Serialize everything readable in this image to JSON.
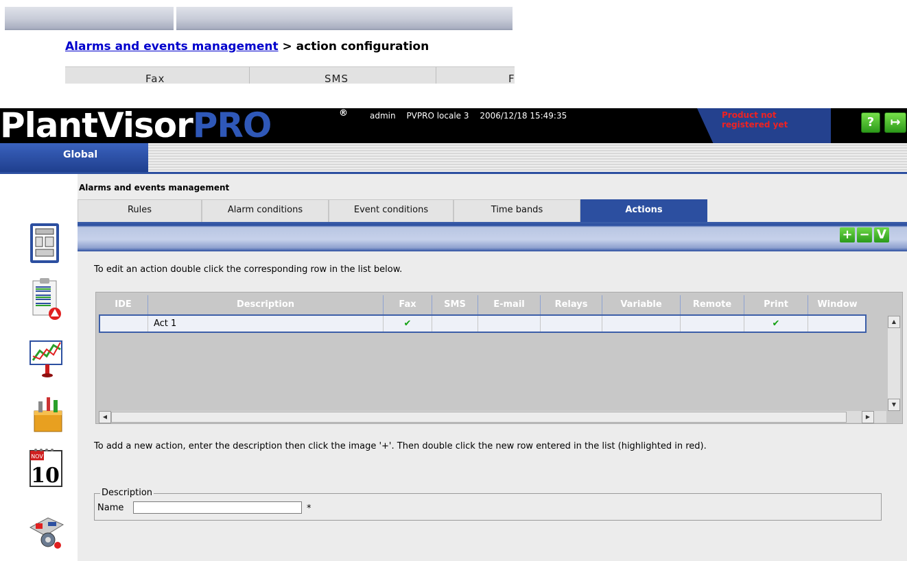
{
  "snippet": {
    "breadcrumb_link": "Alarms and events management",
    "breadcrumb_rest": " > action configuration",
    "tabs": [
      "Fax",
      "SMS",
      "F"
    ]
  },
  "header": {
    "logo_part1": "PlantVisor",
    "logo_part2": "PRO",
    "logo_reg": "®",
    "user": "admin",
    "site": "PVPRO locale 3",
    "datetime": "2006/12/18 15:49:35",
    "notice_line1": "Product not",
    "notice_line2": "registered yet",
    "help_icon": "help-icon",
    "logout_icon": "logout-icon",
    "help_glyph": "?",
    "logout_glyph": "↦"
  },
  "nav": {
    "global_label": "Global"
  },
  "rail_icons": [
    "layout-icon",
    "alarm-list-icon",
    "chart-icon",
    "toolbox-icon",
    "calendar-icon",
    "plant-settings-icon"
  ],
  "calendar": {
    "month": "NOV",
    "day": "10"
  },
  "section": {
    "title": "Alarms and events management",
    "tabs": [
      "Rules",
      "Alarm conditions",
      "Event conditions",
      "Time bands",
      "Actions"
    ],
    "active_tab": "Actions"
  },
  "toolbar": {
    "add": "+",
    "remove": "−",
    "confirm": "V"
  },
  "instructions": {
    "edit": "To edit an action double click the corresponding row in the list below.",
    "add": "To add a new action, enter the description then click the image '+'. Then double click the new row entered in the list (highlighted in red)."
  },
  "table": {
    "columns": [
      "IDE",
      "Description",
      "Fax",
      "SMS",
      "E-mail",
      "Relays",
      "Variable",
      "Remote",
      "Print",
      "Window"
    ],
    "rows": [
      {
        "ide": "",
        "description": "Act 1",
        "fax": "✔",
        "sms": "",
        "email": "",
        "relays": "",
        "variable": "",
        "remote": "",
        "print": "✔",
        "window": ""
      }
    ]
  },
  "scroll_arrows": {
    "up": "▲",
    "down": "▼",
    "left": "◀",
    "right": "▶"
  },
  "form": {
    "legend": "Description",
    "name_label": "Name",
    "name_value": "",
    "required_mark": "*"
  },
  "colors": {
    "accent": "#2c4fa0",
    "notice": "#e22222",
    "check": "#11a011"
  }
}
